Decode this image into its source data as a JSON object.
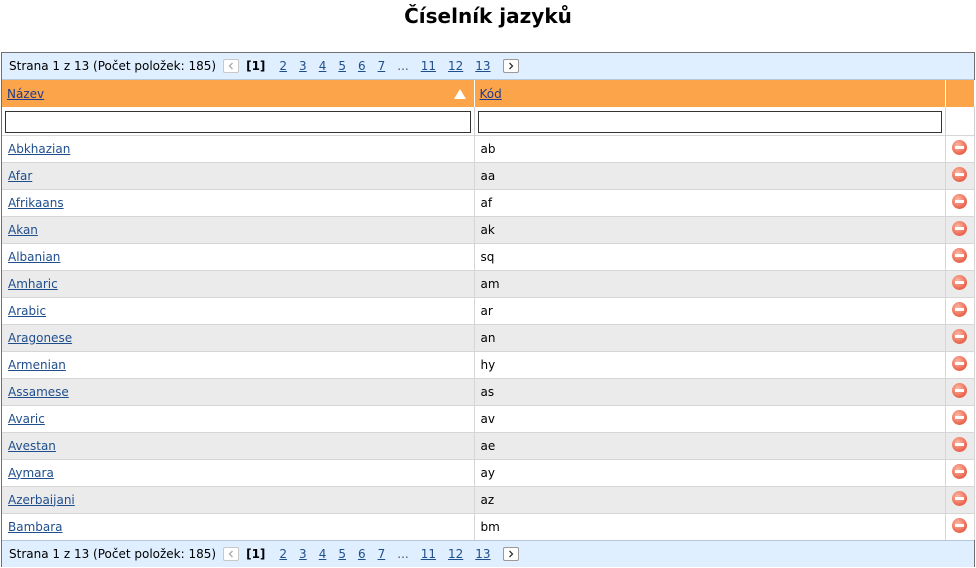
{
  "page_title": "Číselník jazyků",
  "pager": {
    "summary": "Strana 1 z 13 (Počet položek: 185)",
    "current": "[1]",
    "pages": [
      "2",
      "3",
      "4",
      "5",
      "6",
      "7",
      "...",
      "11",
      "12",
      "13"
    ]
  },
  "columns": {
    "name": "Název",
    "code": "Kód"
  },
  "filters": {
    "name_value": "",
    "code_value": ""
  },
  "rows": [
    {
      "name": "Abkhazian",
      "code": "ab"
    },
    {
      "name": "Afar",
      "code": "aa"
    },
    {
      "name": "Afrikaans",
      "code": "af"
    },
    {
      "name": "Akan",
      "code": "ak"
    },
    {
      "name": "Albanian",
      "code": "sq"
    },
    {
      "name": "Amharic",
      "code": "am"
    },
    {
      "name": "Arabic",
      "code": "ar"
    },
    {
      "name": "Aragonese",
      "code": "an"
    },
    {
      "name": "Armenian",
      "code": "hy"
    },
    {
      "name": "Assamese",
      "code": "as"
    },
    {
      "name": "Avaric",
      "code": "av"
    },
    {
      "name": "Avestan",
      "code": "ae"
    },
    {
      "name": "Aymara",
      "code": "ay"
    },
    {
      "name": "Azerbaijani",
      "code": "az"
    },
    {
      "name": "Bambara",
      "code": "bm"
    }
  ],
  "colors": {
    "header_bg": "#fba44a",
    "pager_bg": "#dfefff",
    "link": "#1f4e8c",
    "alt_row": "#ebebeb",
    "delete_icon": "#e8624a"
  },
  "icons": {
    "prev": "chevron-left-icon",
    "next": "chevron-right-icon",
    "sort": "sort-ascending-icon",
    "delete": "delete-icon"
  }
}
